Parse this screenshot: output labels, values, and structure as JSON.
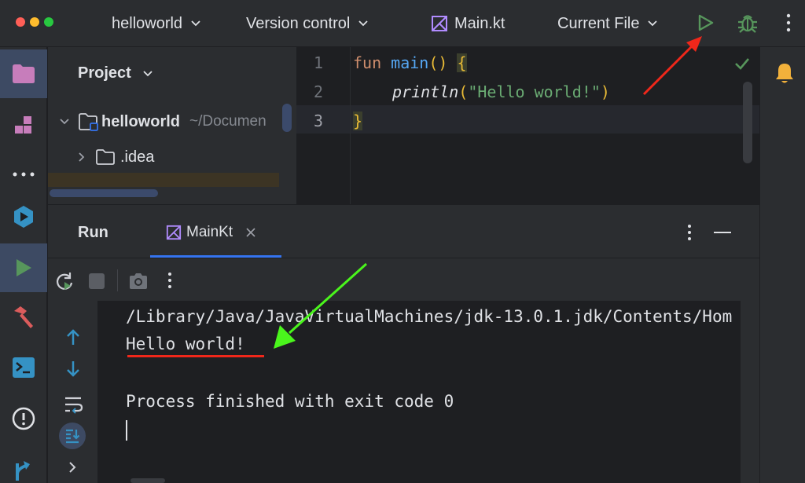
{
  "titlebar": {
    "project_name": "helloworld",
    "vcs_label": "Version control",
    "file_name": "Main.kt",
    "run_config": "Current File"
  },
  "project_pane": {
    "title": "Project",
    "root_name": "helloworld",
    "root_path": "~/Documen",
    "child_folder": ".idea"
  },
  "editor": {
    "line_numbers": [
      "1",
      "2",
      "3"
    ],
    "line1_keyword": "fun",
    "line1_fn": "main",
    "line1_parens": "()",
    "line1_brace": "{",
    "line2_call": "println",
    "line2_open": "(",
    "line2_string": "\"Hello world!\"",
    "line2_close": ")",
    "line3_brace": "}"
  },
  "run_panel": {
    "title": "Run",
    "tab_label": "MainKt",
    "console_lines": [
      "/Library/Java/JavaVirtualMachines/jdk-13.0.1.jdk/Contents/Hom",
      "Hello world!",
      "",
      "Process finished with exit code 0"
    ]
  },
  "colors": {
    "accent_blue": "#3574f0",
    "run_green": "#57965c",
    "annotation_red": "#f0271a",
    "annotation_green": "#4af51c",
    "kotlin_purple": "#b18cff",
    "keyword_orange": "#cf8e6d",
    "function_blue": "#56a8f5",
    "string_green": "#6aab73",
    "bracket_yellow": "#e8ba36",
    "bell_orange": "#f2b13b"
  }
}
